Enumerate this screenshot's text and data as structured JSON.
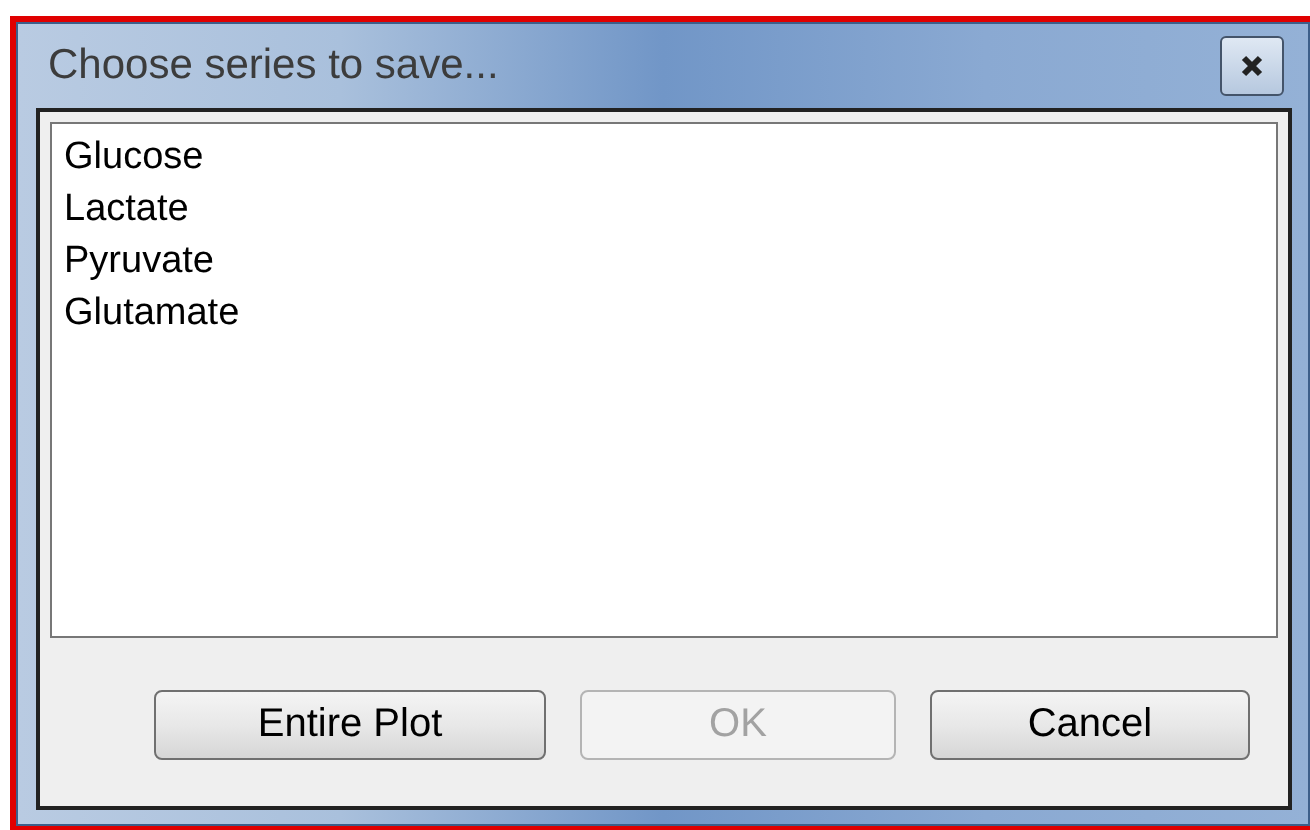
{
  "window": {
    "title": "Choose series to save..."
  },
  "series_list": [
    {
      "label": "Glucose"
    },
    {
      "label": "Lactate"
    },
    {
      "label": "Pyruvate"
    },
    {
      "label": "Glutamate"
    }
  ],
  "buttons": [
    {
      "label": "Entire Plot",
      "disabled": false
    },
    {
      "label": "OK",
      "disabled": true
    },
    {
      "label": "Cancel",
      "disabled": false
    }
  ]
}
